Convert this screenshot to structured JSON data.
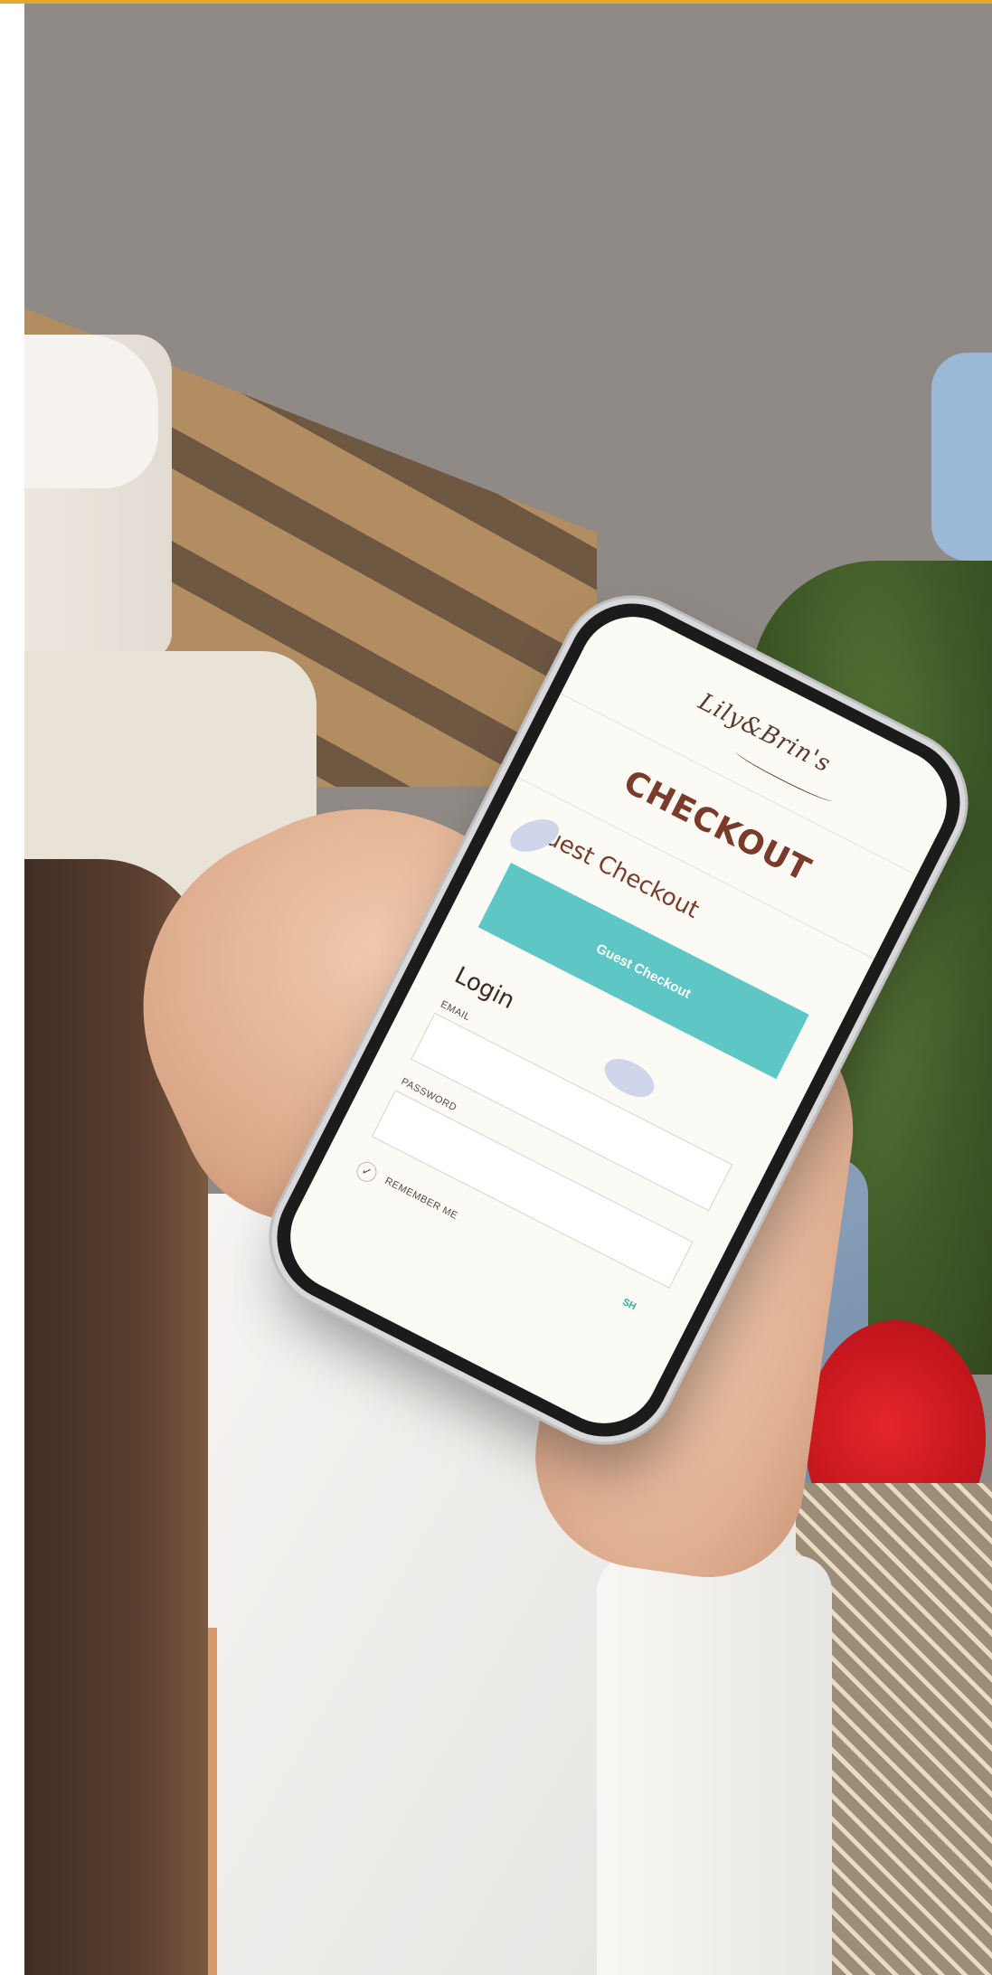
{
  "brand": {
    "logo_text": "Lily&Brin's",
    "accent_color": "#e3a92e",
    "primary_color": "#7a3b2a",
    "button_color": "#5ec6c4"
  },
  "checkout": {
    "title": "CHECKOUT",
    "guest_heading": "Guest Checkout",
    "guest_button_label": "Guest Checkout"
  },
  "login": {
    "heading": "Login",
    "email_label": "EMAIL",
    "password_label": "PASSWORD",
    "remember_label": "REMEMBER ME",
    "show_label": "SH"
  },
  "icons": {
    "checkbox": "check-icon"
  }
}
